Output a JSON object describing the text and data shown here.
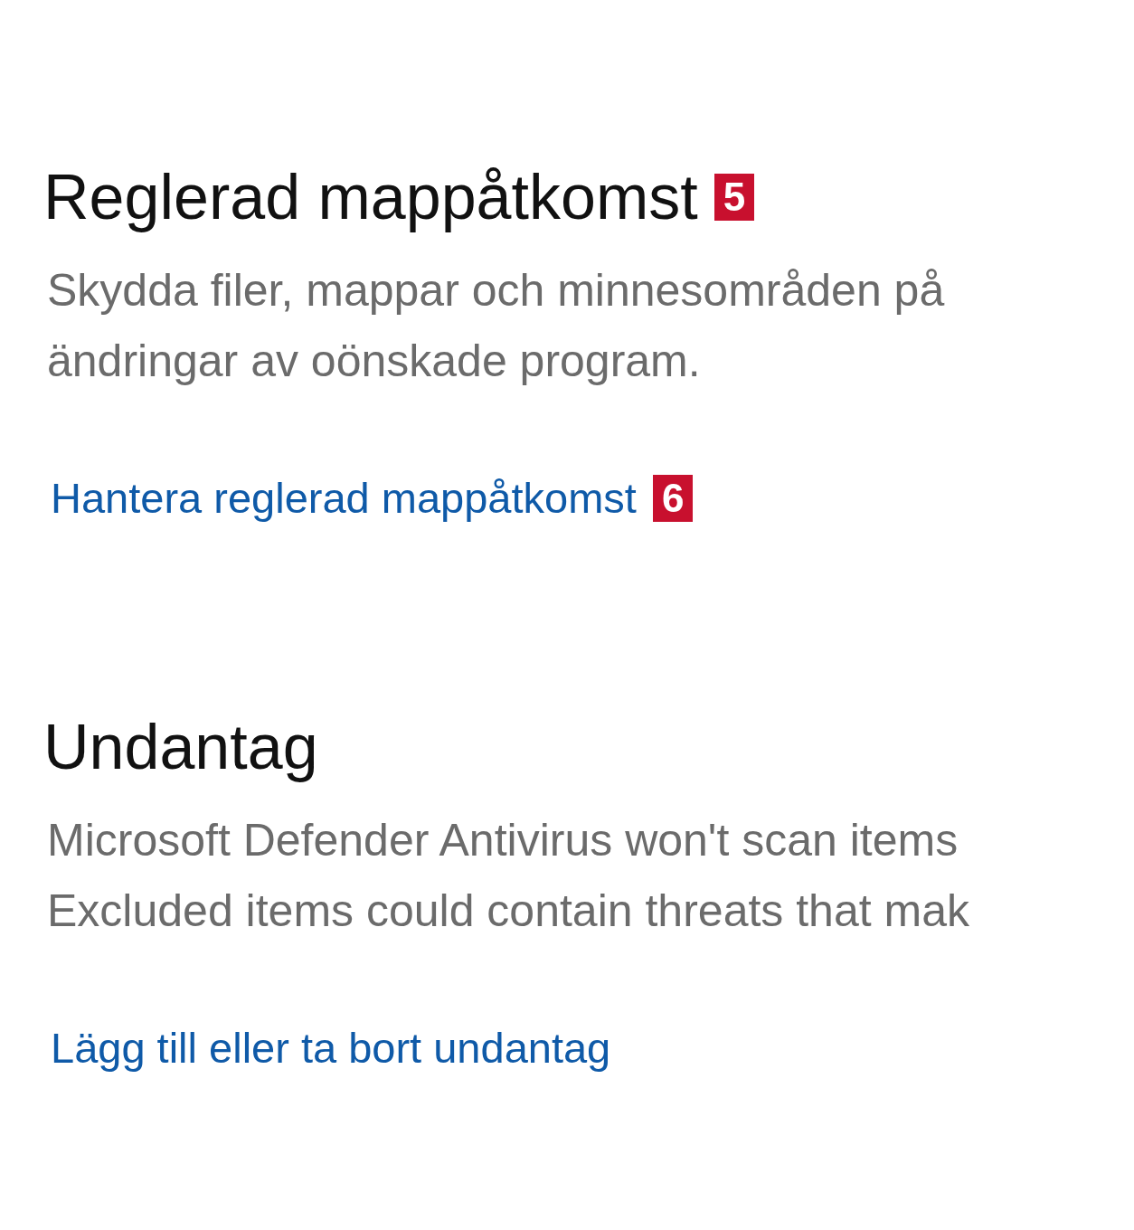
{
  "sections": [
    {
      "title": "Reglerad mappåtkomst",
      "title_badge": "5",
      "description": [
        "Skydda filer, mappar och minnesområden på",
        "ändringar av oönskade program."
      ],
      "link": "Hantera reglerad mappåtkomst",
      "link_badge": "6"
    },
    {
      "title": "Undantag",
      "description": [
        "Microsoft Defender Antivirus won't scan items",
        "Excluded items could contain threats that mak"
      ],
      "link": "Lägg till eller ta bort undantag"
    }
  ]
}
